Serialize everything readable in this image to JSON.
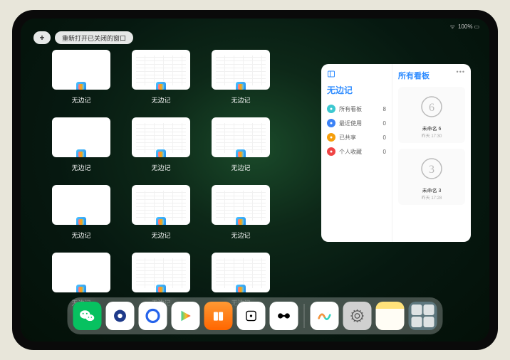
{
  "status": {
    "battery": "100%"
  },
  "topbar": {
    "plus_label": "+",
    "pill_label": "重新打开已关闭的窗口"
  },
  "windows": [
    {
      "label": "无边记",
      "thumb": "blank"
    },
    {
      "label": "无边记",
      "thumb": "detail"
    },
    {
      "label": "无边记",
      "thumb": "detail"
    },
    {
      "label": "无边记",
      "thumb": "blank"
    },
    {
      "label": "无边记",
      "thumb": "detail"
    },
    {
      "label": "无边记",
      "thumb": "detail"
    },
    {
      "label": "无边记",
      "thumb": "blank"
    },
    {
      "label": "无边记",
      "thumb": "detail"
    },
    {
      "label": "无边记",
      "thumb": "detail"
    },
    {
      "label": "无边记",
      "thumb": "blank"
    },
    {
      "label": "无边记",
      "thumb": "detail"
    },
    {
      "label": "无边记",
      "thumb": "detail"
    }
  ],
  "panel": {
    "app_name": "无边记",
    "right_title": "所有看板",
    "rows": [
      {
        "icon": "grid",
        "color": "#3cc8d0",
        "label": "所有看板",
        "count": "8"
      },
      {
        "icon": "clock",
        "color": "#3b82f6",
        "label": "最近使用",
        "count": "0"
      },
      {
        "icon": "people",
        "color": "#f59e0b",
        "label": "已共享",
        "count": "0"
      },
      {
        "icon": "heart",
        "color": "#ef4444",
        "label": "个人收藏",
        "count": "0"
      }
    ],
    "boards": [
      {
        "glyph": "6",
        "label": "未命名 6",
        "sub": "昨天 17:30"
      },
      {
        "glyph": "3",
        "label": "未命名 3",
        "sub": "昨天 17:28"
      }
    ]
  },
  "dock": {
    "apps": [
      {
        "name": "wechat",
        "bg": "#07c160",
        "glyph": "wechat"
      },
      {
        "name": "quark-hd",
        "bg": "#ffffff",
        "glyph": "quark-blue"
      },
      {
        "name": "quark",
        "bg": "#ffffff",
        "glyph": "quark-ring"
      },
      {
        "name": "play",
        "bg": "#ffffff",
        "glyph": "play"
      },
      {
        "name": "books",
        "bg": "linear-gradient(180deg,#ff9933,#ff6600)",
        "glyph": "books"
      },
      {
        "name": "dice",
        "bg": "#ffffff",
        "glyph": "dice"
      },
      {
        "name": "connect",
        "bg": "#ffffff",
        "glyph": "barbell"
      }
    ],
    "recent": [
      {
        "name": "freeform",
        "bg": "#ffffff",
        "glyph": "freeform"
      },
      {
        "name": "settings",
        "bg": "#d0d0d0",
        "glyph": "gear"
      },
      {
        "name": "notes",
        "bg": "linear-gradient(180deg,#ffe27a 0%,#ffe27a 25%,#fffdf5 25%)",
        "glyph": ""
      },
      {
        "name": "folder",
        "bg": "",
        "glyph": "folder"
      }
    ]
  }
}
